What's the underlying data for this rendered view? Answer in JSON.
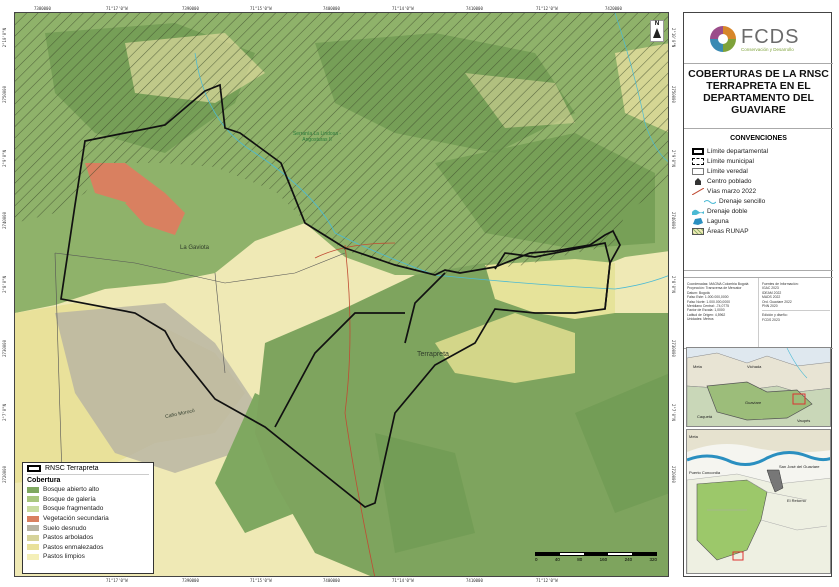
{
  "map": {
    "coords_top": [
      "7380000",
      "71°17'0\"W",
      "7390000",
      "71°15'0\"W",
      "7400000",
      "71°14'0\"W",
      "7410000",
      "71°12'0\"W",
      "7420000"
    ],
    "coords_bottom": [
      "71°17'0\"W",
      "7390000",
      "71°15'0\"W",
      "7400000",
      "71°14'0\"W",
      "7410000",
      "71°12'0\"W"
    ],
    "coords_left": [
      "2°10'0\"N",
      "2750000",
      "2°9'0\"N",
      "2740000",
      "2°8'0\"N",
      "2730000",
      "2°7'0\"N",
      "2720000"
    ],
    "coords_right": [
      "2°10'0\"N",
      "2750000",
      "2°9'0\"N",
      "2740000",
      "2°8'0\"N",
      "2730000",
      "2°7'0\"N",
      "2720000"
    ],
    "north_letter": "N",
    "labels": {
      "gaviota": "La Gaviota",
      "terrapreta": "Terrapreta",
      "cano": "Caño Morocó",
      "runap": "Serranía La Lindosa - Angosturas II"
    }
  },
  "legend": {
    "rnsc_label": "RNSC Terrapreta",
    "cobertura_title": "Cobertura",
    "items": [
      {
        "label": "Bosque abierto alto",
        "color": "#7fa860"
      },
      {
        "label": "Bosque de galería",
        "color": "#a9c77f"
      },
      {
        "label": "Bosque fragmentado",
        "color": "#c9dca0"
      },
      {
        "label": "Vegetación secundaria",
        "color": "#d98060"
      },
      {
        "label": "Suelo desnudo",
        "color": "#b7b3a3"
      },
      {
        "label": "Pastos arbolados",
        "color": "#d6d39a"
      },
      {
        "label": "Pastos enmalezados",
        "color": "#e9e19a"
      },
      {
        "label": "Pastos limpios",
        "color": "#f4efb8"
      }
    ]
  },
  "scalebar": {
    "ticks": [
      "0",
      "40",
      "80",
      "160",
      "240",
      "320"
    ]
  },
  "panel": {
    "logo_name": "FCDS",
    "logo_sub": "Conservación y Desarrollo",
    "title": "COBERTURAS DE LA RNSC TERRAPRETA EN EL DEPARTAMENTO DEL GUAVIARE",
    "conventions_title": "CONVENCIONES",
    "conventions": [
      {
        "label": "Límite departamental",
        "sym": "dept"
      },
      {
        "label": "Límite municipal",
        "sym": "muni"
      },
      {
        "label": "Límite veredal",
        "sym": "vered"
      },
      {
        "label": "Centro poblado",
        "sym": "poblado"
      },
      {
        "label": "Vías marzo 2022",
        "sym": "vias"
      },
      {
        "label": "Drenaje sencillo",
        "sym": "drenaje"
      },
      {
        "label": "Drenaje doble",
        "sym": "doble"
      },
      {
        "label": "Laguna",
        "sym": "laguna"
      },
      {
        "label": "Áreas RUNAP",
        "sym": "runap"
      }
    ],
    "meta_left": [
      "Coordenadas: MAGNA Colombia Bogotá",
      "Proyección: Transversa de Mercator",
      "Datum: Bogotá",
      "Falso Este: 1.000.000,0000",
      "Falso Norte: 1.000.000,0000",
      "Meridiano Central: -74,0775",
      "Factor de Escala: 1,0000",
      "Latitud de Origen: 4,5962",
      "Unidades: Metros"
    ],
    "meta_right": [
      "Fuentes de Información:",
      "IGAC 2023",
      "IDEAM 2022",
      "MADS 2022",
      "Ord. Guaviare 2022",
      "PNN 2020"
    ],
    "meta_right2": [
      "Edición y diseño:",
      "FCDS 2023"
    ],
    "inset_labels": {
      "meta": "Meta",
      "guaviare": "Guaviare",
      "vichada": "Vichada",
      "caqueta": "Caquetá",
      "vaupes": "Vaupés",
      "san_jose": "San José del Guaviare",
      "el_retorno": "El Retorno",
      "puerto_concordia": "Puerto Concordia"
    }
  }
}
